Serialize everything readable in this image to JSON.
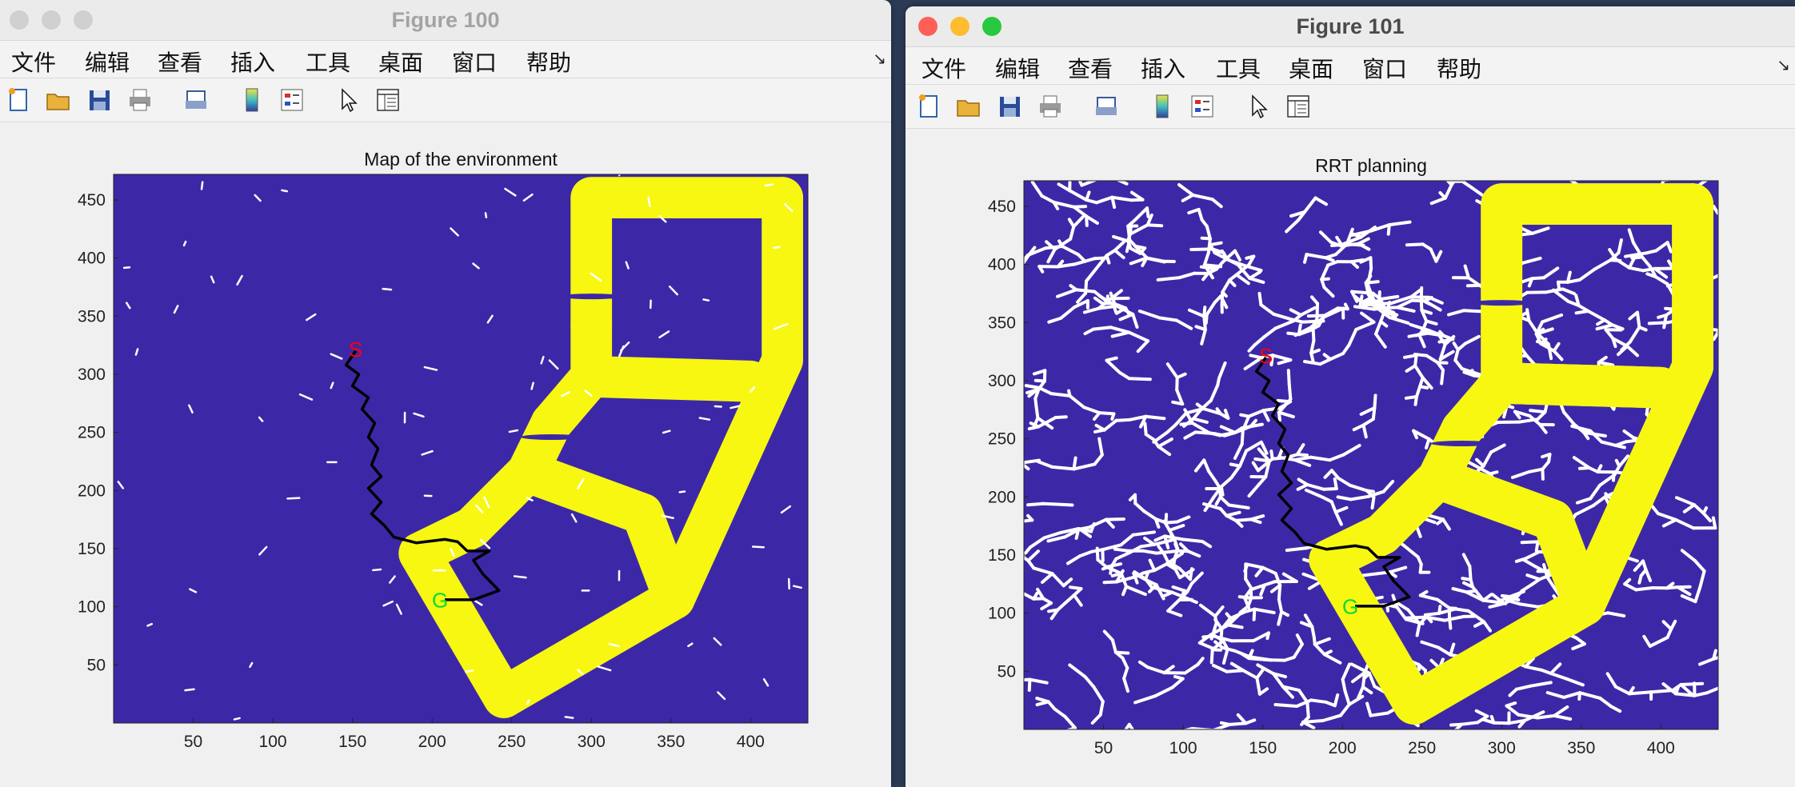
{
  "windows": [
    {
      "title": "Figure 100",
      "active": false,
      "menu": [
        "文件",
        "编辑",
        "查看",
        "插入",
        "工具",
        "桌面",
        "窗口",
        "帮助"
      ],
      "toolbar_icons": [
        "new-file-icon",
        "open-folder-icon",
        "save-icon",
        "print-icon",
        "print-preview-icon",
        "colorbar-icon",
        "legend-icon",
        "pointer-icon",
        "property-inspector-icon"
      ],
      "plot": {
        "title": "Map of the environment",
        "show_tree": false
      }
    },
    {
      "title": "Figure 101",
      "active": true,
      "menu": [
        "文件",
        "编辑",
        "查看",
        "插入",
        "工具",
        "桌面",
        "窗口",
        "帮助"
      ],
      "toolbar_icons": [
        "new-file-icon",
        "open-folder-icon",
        "save-icon",
        "print-icon",
        "print-preview-icon",
        "colorbar-icon",
        "legend-icon",
        "pointer-icon",
        "property-inspector-icon"
      ],
      "plot": {
        "title": "RRT planning",
        "show_tree": true
      }
    }
  ],
  "chart_data": {
    "type": "map",
    "xlim": [
      0,
      436
    ],
    "ylim": [
      0,
      472
    ],
    "x_ticks": [
      50,
      100,
      150,
      200,
      250,
      300,
      350,
      400
    ],
    "y_ticks": [
      50,
      100,
      150,
      200,
      250,
      300,
      350,
      400,
      450
    ],
    "colors": {
      "free_space": "#3c28a7",
      "obstacle": "#f7f712",
      "tree": "#ffffff",
      "path": "#000000",
      "start": "#ff0000",
      "goal": "#00dd33"
    },
    "start": {
      "label": "S",
      "x": 152,
      "y": 320
    },
    "goal": {
      "label": "G",
      "x": 205,
      "y": 104
    },
    "obstacle_width": 26,
    "obstacle_segments": [
      [
        [
          245,
          22
        ],
        [
          352,
          107
        ],
        [
          420,
          312
        ],
        [
          420,
          452
        ]
      ],
      [
        [
          420,
          452
        ],
        [
          300,
          452
        ],
        [
          300,
          342
        ]
      ],
      [
        [
          300,
          342
        ],
        [
          300,
          298
        ],
        [
          275,
          258
        ]
      ],
      [
        [
          300,
          298
        ],
        [
          400,
          294
        ]
      ],
      [
        [
          275,
          258
        ],
        [
          260,
          216
        ],
        [
          225,
          168
        ]
      ],
      [
        [
          260,
          216
        ],
        [
          332,
          180
        ],
        [
          352,
          107
        ]
      ],
      [
        [
          225,
          168
        ],
        [
          192,
          146
        ],
        [
          245,
          22
        ]
      ]
    ],
    "obstacle_gaps": [
      {
        "x": 300,
        "y": 367
      },
      {
        "x": 275,
        "y": 246
      }
    ],
    "path": [
      [
        152,
        320
      ],
      [
        146,
        308
      ],
      [
        154,
        300
      ],
      [
        150,
        290
      ],
      [
        160,
        280
      ],
      [
        156,
        270
      ],
      [
        164,
        258
      ],
      [
        160,
        246
      ],
      [
        166,
        236
      ],
      [
        162,
        222
      ],
      [
        168,
        212
      ],
      [
        160,
        202
      ],
      [
        168,
        190
      ],
      [
        162,
        180
      ],
      [
        170,
        170
      ],
      [
        176,
        160
      ],
      [
        190,
        155
      ],
      [
        208,
        158
      ],
      [
        216,
        156
      ],
      [
        222,
        148
      ],
      [
        236,
        148
      ],
      [
        226,
        140
      ],
      [
        232,
        128
      ],
      [
        242,
        114
      ],
      [
        226,
        106
      ],
      [
        208,
        106
      ]
    ]
  }
}
